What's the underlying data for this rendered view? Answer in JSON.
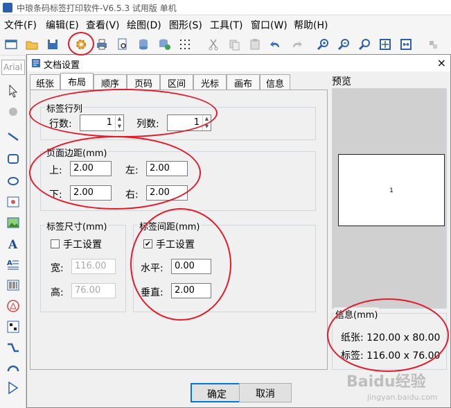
{
  "app": {
    "title": "中琅条码标签打印软件-V6.5.3 试用版 单机"
  },
  "menu": [
    "文件(F)",
    "编辑(E)",
    "查看(V)",
    "绘图(D)",
    "图形(S)",
    "工具(T)",
    "窗口(W)",
    "帮助(H)"
  ],
  "font_box": "Arial",
  "dialog": {
    "title": "文档设置",
    "tabs": [
      "纸张",
      "布局",
      "顺序",
      "页码",
      "区间",
      "光标",
      "画布",
      "信息"
    ],
    "active_tab": "布局",
    "rows_cols": {
      "label": "标签行列",
      "rows_label": "行数:",
      "rows": "1",
      "cols_label": "列数:",
      "cols": "1"
    },
    "margins": {
      "label": "页面边距(mm)",
      "top_label": "上:",
      "top": "2.00",
      "left_label": "左:",
      "left": "2.00",
      "bottom_label": "下:",
      "bottom": "2.00",
      "right_label": "右:",
      "right": "2.00"
    },
    "label_size": {
      "label": "标签尺寸(mm)",
      "manual": "手工设置",
      "width_label": "宽:",
      "width": "116.00",
      "height_label": "高:",
      "height": "76.00"
    },
    "spacing": {
      "label": "标签间距(mm)",
      "manual": "手工设置",
      "h_label": "水平:",
      "h": "0.00",
      "v_label": "垂直:",
      "v": "2.00"
    },
    "preview": {
      "label": "预览",
      "page_number": "1"
    },
    "info": {
      "label": "信息(mm)",
      "paper": "纸张: 120.00 x 80.00",
      "tag": "标签: 116.00 x 76.00"
    },
    "ok": "确定",
    "cancel": "取消",
    "close": "×"
  },
  "watermark": "Baidu经验",
  "watermark_url": "jingyan.baidu.com"
}
